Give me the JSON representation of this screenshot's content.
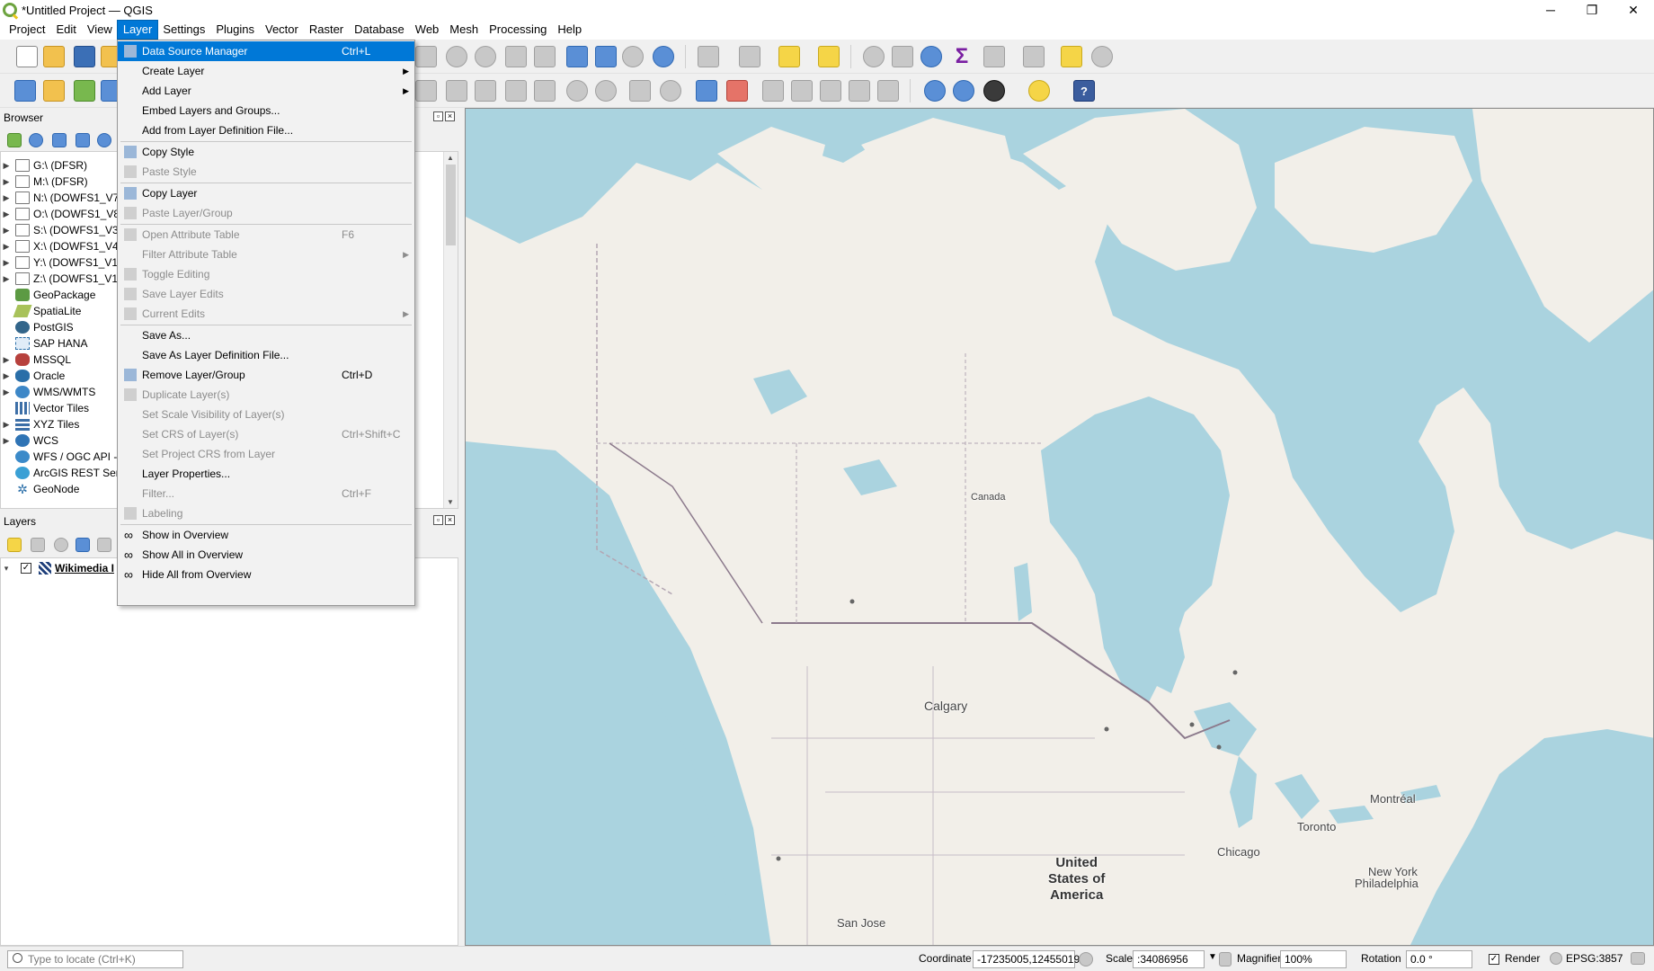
{
  "window": {
    "title": "*Untitled Project — QGIS",
    "controls": [
      "─",
      "❐",
      "✕"
    ]
  },
  "menubar": [
    "Project",
    "Edit",
    "View",
    "Layer",
    "Settings",
    "Plugins",
    "Vector",
    "Raster",
    "Database",
    "Web",
    "Mesh",
    "Processing",
    "Help"
  ],
  "browser": {
    "title": "Browser",
    "items": [
      {
        "label": "G:\\ (DFSR)",
        "icon": "folder-icon",
        "expandable": true
      },
      {
        "label": "M:\\ (DFSR)",
        "icon": "folder-icon",
        "expandable": true
      },
      {
        "label": "N:\\ (DOWFS1_V7",
        "icon": "folder-icon",
        "expandable": true
      },
      {
        "label": "O:\\ (DOWFS1_V8",
        "icon": "folder-icon",
        "expandable": true
      },
      {
        "label": "S:\\ (DOWFS1_V3)",
        "icon": "folder-icon",
        "expandable": true
      },
      {
        "label": "X:\\ (DOWFS1_V4)",
        "icon": "folder-icon",
        "expandable": true
      },
      {
        "label": "Y:\\ (DOWFS1_V1(",
        "icon": "folder-icon",
        "expandable": true
      },
      {
        "label": "Z:\\ (DOWFS1_V1",
        "icon": "folder-icon",
        "expandable": true
      },
      {
        "label": "GeoPackage",
        "icon": "geopackage-icon",
        "expandable": false
      },
      {
        "label": "SpatiaLite",
        "icon": "spatialite-icon",
        "expandable": false
      },
      {
        "label": "PostGIS",
        "icon": "postgis-icon",
        "expandable": false
      },
      {
        "label": "SAP HANA",
        "icon": "sap-hana-icon",
        "expandable": false
      },
      {
        "label": "MSSQL",
        "icon": "mssql-icon",
        "expandable": true
      },
      {
        "label": "Oracle",
        "icon": "oracle-icon",
        "expandable": true
      },
      {
        "label": "WMS/WMTS",
        "icon": "wms-icon",
        "expandable": true
      },
      {
        "label": "Vector Tiles",
        "icon": "vector-tiles-icon",
        "expandable": false
      },
      {
        "label": "XYZ Tiles",
        "icon": "xyz-tiles-icon",
        "expandable": true
      },
      {
        "label": "WCS",
        "icon": "wcs-icon",
        "expandable": true
      },
      {
        "label": "WFS / OGC API -",
        "icon": "wfs-icon",
        "expandable": false
      },
      {
        "label": "ArcGIS REST Serv",
        "icon": "arcgis-icon",
        "expandable": false
      },
      {
        "label": "GeoNode",
        "icon": "geonode-icon",
        "expandable": false
      }
    ]
  },
  "layers": {
    "title": "Layers",
    "items": [
      {
        "label": "Wikimedia I",
        "checked": true
      }
    ]
  },
  "layer_menu": [
    {
      "type": "item",
      "label": "Data Source Manager",
      "shortcut": "Ctrl+L",
      "highlighted": true,
      "icon": "data-source-manager-icon"
    },
    {
      "type": "item",
      "label": "Create Layer",
      "submenu": true
    },
    {
      "type": "item",
      "label": "Add Layer",
      "submenu": true
    },
    {
      "type": "item",
      "label": "Embed Layers and Groups..."
    },
    {
      "type": "item",
      "label": "Add from Layer Definition File..."
    },
    {
      "type": "separator"
    },
    {
      "type": "item",
      "label": "Copy Style",
      "icon": "copy-style-icon"
    },
    {
      "type": "item",
      "label": "Paste Style",
      "disabled": true,
      "icon": "paste-style-icon"
    },
    {
      "type": "separator"
    },
    {
      "type": "item",
      "label": "Copy Layer",
      "icon": "copy-layer-icon"
    },
    {
      "type": "item",
      "label": "Paste Layer/Group",
      "disabled": true,
      "icon": "paste-layer-icon"
    },
    {
      "type": "separator"
    },
    {
      "type": "item",
      "label": "Open Attribute Table",
      "shortcut": "F6",
      "disabled": true,
      "icon": "attribute-table-icon"
    },
    {
      "type": "item",
      "label": "Filter Attribute Table",
      "disabled": true,
      "submenu": true
    },
    {
      "type": "item",
      "label": "Toggle Editing",
      "disabled": true,
      "icon": "pencil-icon"
    },
    {
      "type": "item",
      "label": "Save Layer Edits",
      "disabled": true,
      "icon": "save-edits-icon"
    },
    {
      "type": "item",
      "label": "Current Edits",
      "disabled": true,
      "submenu": true,
      "icon": "current-edits-icon"
    },
    {
      "type": "separator"
    },
    {
      "type": "item",
      "label": "Save As..."
    },
    {
      "type": "item",
      "label": "Save As Layer Definition File..."
    },
    {
      "type": "item",
      "label": "Remove Layer/Group",
      "shortcut": "Ctrl+D",
      "icon": "remove-layer-icon"
    },
    {
      "type": "item",
      "label": "Duplicate Layer(s)",
      "disabled": true,
      "icon": "duplicate-layer-icon"
    },
    {
      "type": "item",
      "label": "Set Scale Visibility of Layer(s)",
      "disabled": true
    },
    {
      "type": "item",
      "label": "Set CRS of Layer(s)",
      "shortcut": "Ctrl+Shift+C",
      "disabled": true
    },
    {
      "type": "item",
      "label": "Set Project CRS from Layer",
      "disabled": true
    },
    {
      "type": "item",
      "label": "Layer Properties..."
    },
    {
      "type": "item",
      "label": "Filter...",
      "shortcut": "Ctrl+F",
      "disabled": true
    },
    {
      "type": "item",
      "label": "Labeling",
      "disabled": true,
      "icon": "labeling-icon"
    },
    {
      "type": "separator"
    },
    {
      "type": "item",
      "label": "Show in Overview",
      "icon": "overview-icon"
    },
    {
      "type": "item",
      "label": "Show All in Overview",
      "icon": "overview-icon"
    },
    {
      "type": "item",
      "label": "Hide All from Overview",
      "icon": "hide-overview-icon"
    }
  ],
  "map": {
    "labels": {
      "canada": "Canada",
      "calgary": "Calgary",
      "usa1": "United",
      "usa2": "States of",
      "usa3": "America",
      "chicago": "Chicago",
      "toronto": "Toronto",
      "montreal": "Montréal",
      "newyork1": "New York",
      "newyork2": "Philadelphia",
      "sanjose": "San Jose"
    },
    "colors": {
      "water": "#aad3df",
      "land": "#f2efe9"
    }
  },
  "status": {
    "locator_placeholder": "Type to locate (Ctrl+K)",
    "coordinate_label": "Coordinate",
    "coordinate_value": "-17235005,12455019",
    "scale_label": "Scale",
    "scale_value": ":34086956",
    "magnifier_label": "Magnifier",
    "magnifier_value": "100%",
    "rotation_label": "Rotation",
    "rotation_value": "0.0 °",
    "render_label": "Render",
    "crs": "EPSG:3857"
  }
}
